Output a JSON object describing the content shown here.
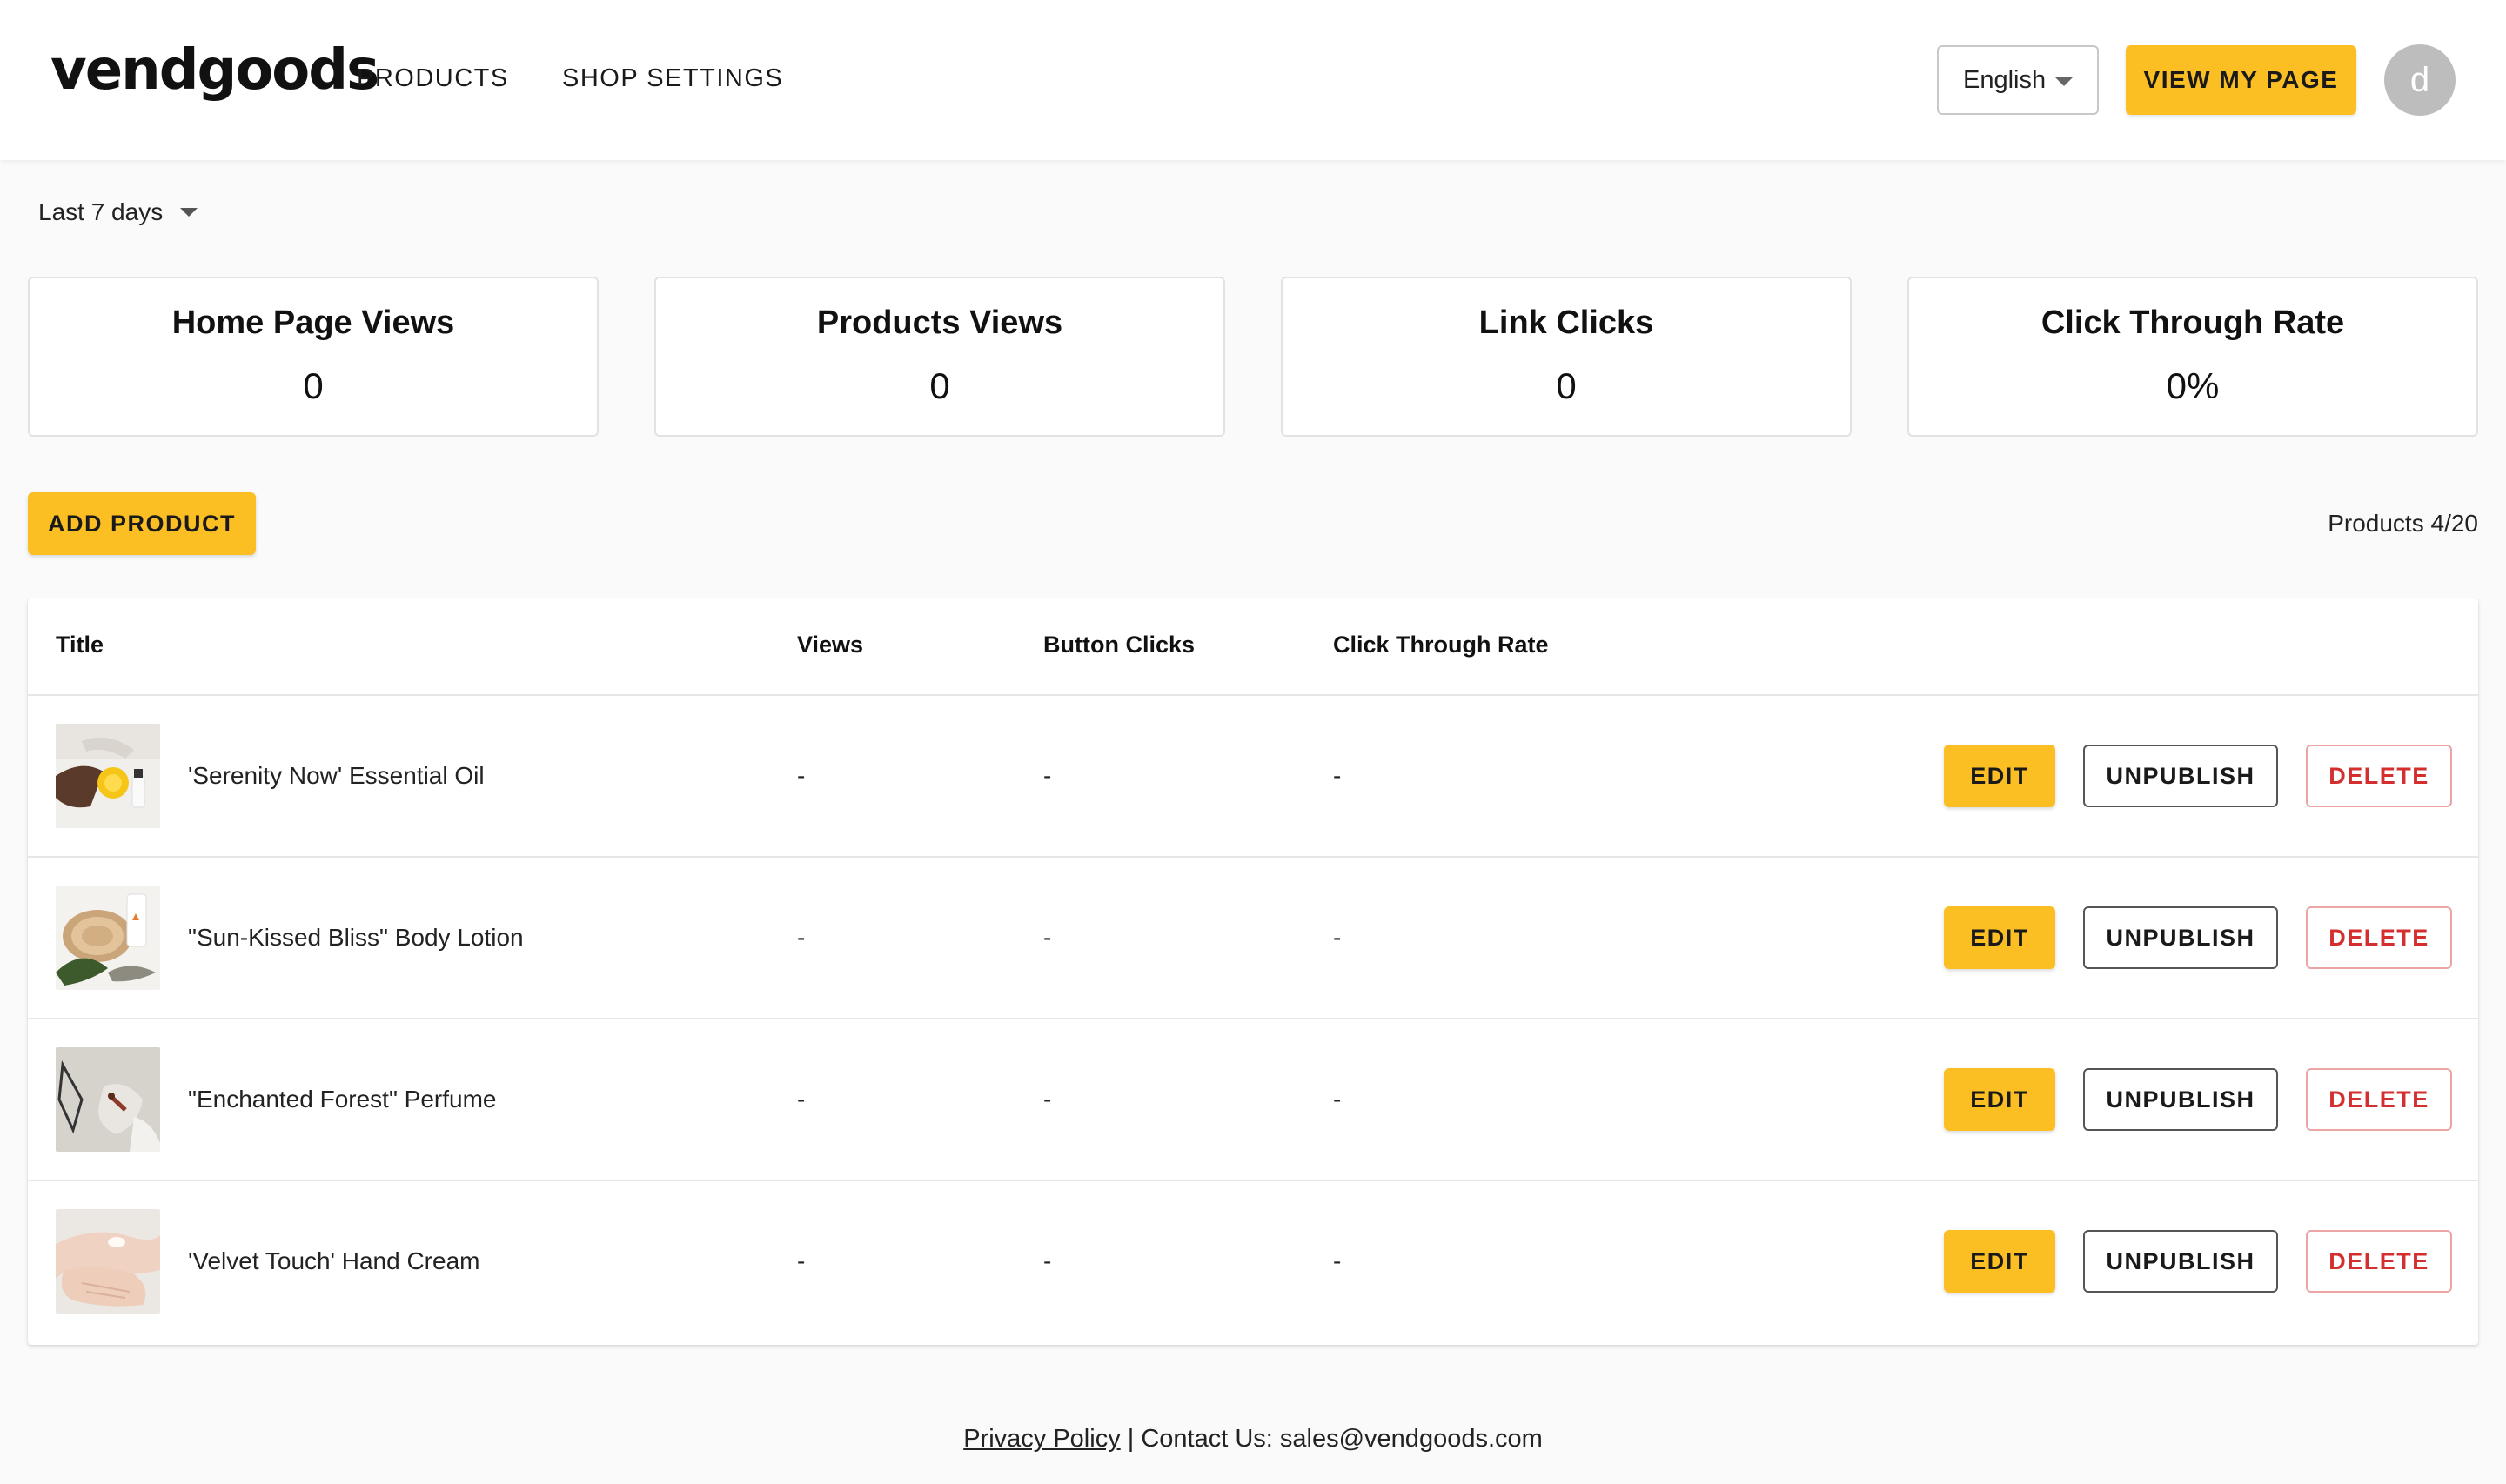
{
  "header": {
    "logo": "vendgoods",
    "nav": [
      {
        "label": "PRODUCTS"
      },
      {
        "label": "SHOP SETTINGS"
      }
    ],
    "language": "English",
    "view_page_label": "VIEW MY PAGE",
    "avatar_initial": "d"
  },
  "filters": {
    "period": "Last 7 days"
  },
  "stats": [
    {
      "label": "Home Page Views",
      "value": "0"
    },
    {
      "label": "Products Views",
      "value": "0"
    },
    {
      "label": "Link Clicks",
      "value": "0"
    },
    {
      "label": "Click Through Rate",
      "value": "0%"
    }
  ],
  "toolbar": {
    "add_label": "ADD PRODUCT",
    "products_count": "Products 4/20"
  },
  "table": {
    "columns": [
      "Title",
      "Views",
      "Button Clicks",
      "Click Through Rate"
    ],
    "actions": {
      "edit": "EDIT",
      "unpublish": "UNPUBLISH",
      "delete": "DELETE"
    },
    "rows": [
      {
        "title": "'Serenity Now' Essential Oil",
        "views": "-",
        "clicks": "-",
        "ctr": "-"
      },
      {
        "title": "\"Sun-Kissed Bliss\" Body Lotion",
        "views": "-",
        "clicks": "-",
        "ctr": "-"
      },
      {
        "title": "\"Enchanted Forest\" Perfume",
        "views": "-",
        "clicks": "-",
        "ctr": "-"
      },
      {
        "title": "'Velvet Touch' Hand Cream",
        "views": "-",
        "clicks": "-",
        "ctr": "-"
      }
    ]
  },
  "footer": {
    "privacy_label": "Privacy Policy",
    "separator": " | ",
    "contact": "Contact Us: sales@vendgoods.com"
  },
  "colors": {
    "accent": "#fbbf24",
    "danger": "#d32f2f",
    "background": "#fafafa"
  }
}
